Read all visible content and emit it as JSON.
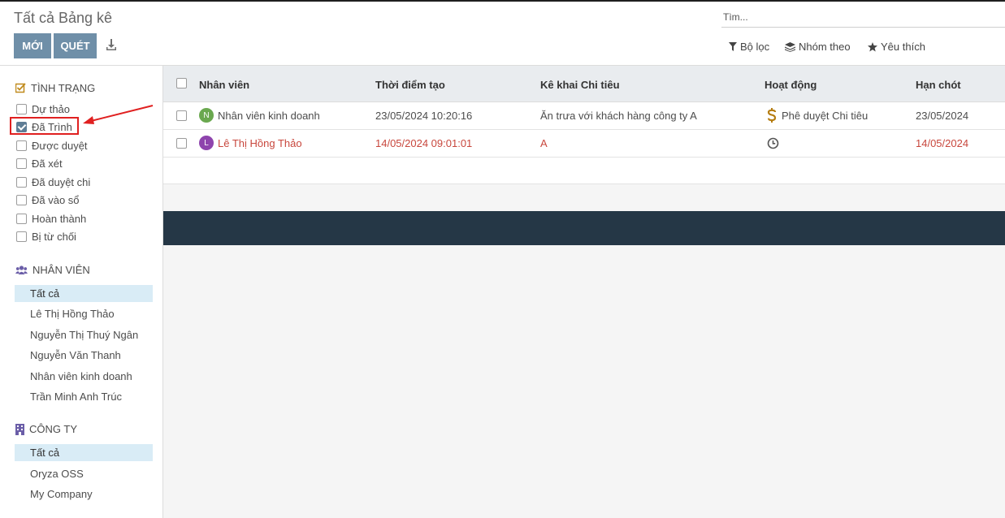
{
  "breadcrumb": "Tất cả Bảng kê",
  "buttons": {
    "new": "MỚI",
    "scan": "QUÉT"
  },
  "search": {
    "placeholder": "Tìm..."
  },
  "filter_options": {
    "filters": "Bộ lọc",
    "group_by": "Nhóm theo",
    "favorites": "Yêu thích"
  },
  "sidebar": {
    "status": {
      "title": "TÌNH TRẠNG",
      "items": [
        {
          "label": "Dự thảo",
          "checked": false
        },
        {
          "label": "Đã Trình",
          "checked": true
        },
        {
          "label": "Được duyệt",
          "checked": false
        },
        {
          "label": "Đã xét",
          "checked": false
        },
        {
          "label": "Đã duyệt chi",
          "checked": false
        },
        {
          "label": "Đã vào sổ",
          "checked": false
        },
        {
          "label": "Hoàn thành",
          "checked": false
        },
        {
          "label": "Bị từ chối",
          "checked": false
        }
      ]
    },
    "employee": {
      "title": "NHÂN VIÊN",
      "items": [
        "Tất cả",
        "Lê Thị Hồng Thảo",
        "Nguyễn Thị Thuý Ngân",
        "Nguyễn Văn Thanh",
        "Nhân viên kinh doanh",
        "Trần Minh Anh Trúc"
      ]
    },
    "company": {
      "title": "CÔNG TY",
      "items": [
        "Tất cả",
        "Oryza OSS",
        "My Company"
      ]
    }
  },
  "table": {
    "columns": [
      "Nhân viên",
      "Thời điểm tạo",
      "Kê khai Chi tiêu",
      "Hoạt động",
      "Hạn chót"
    ],
    "rows": [
      {
        "avatar": "N",
        "avatar_color": "#6aa84f",
        "employee": "Nhân viên kinh doanh",
        "created": "23/05/2024 10:20:16",
        "expense": "Ăn trưa với khách hàng công ty A",
        "activity": "Phê duyệt Chi tiêu",
        "activity_icon": "dollar-icon",
        "deadline": "23/05/2024"
      },
      {
        "avatar": "L",
        "avatar_color": "#8e44ad",
        "employee": "Lê Thị Hồng Thảo",
        "created": "14/05/2024 09:01:01",
        "expense": "A",
        "activity": "",
        "activity_icon": "clock-icon",
        "deadline": "14/05/2024"
      }
    ]
  },
  "colors": {
    "primary_button": "#6f8fa8",
    "overdue_text": "#c8473d",
    "active_item": "#d9ecf6",
    "footer_band": "#253746"
  }
}
